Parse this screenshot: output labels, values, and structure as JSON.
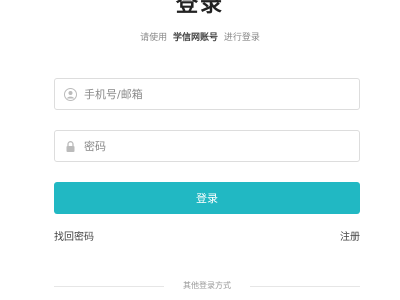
{
  "page": {
    "title": "登录",
    "subtitle_prefix": "请使用",
    "subtitle_brand": "学信网账号",
    "subtitle_suffix": "进行登录"
  },
  "form": {
    "account": {
      "placeholder": "手机号/邮箱",
      "value": "",
      "icon": "user-icon"
    },
    "password": {
      "placeholder": "密码",
      "value": "",
      "icon": "lock-icon"
    },
    "submit_label": "登录"
  },
  "links": {
    "forgot_password": "找回密码",
    "register": "注册"
  },
  "other_login": {
    "label": "其他登录方式"
  },
  "colors": {
    "accent": "#21b8c3",
    "border": "#dddddd"
  }
}
